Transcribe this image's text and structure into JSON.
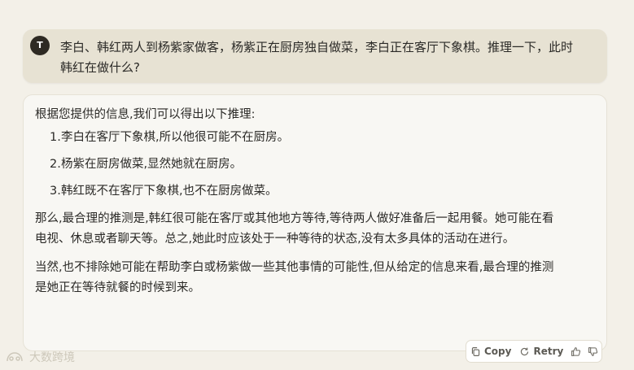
{
  "user": {
    "avatar_initial": "T",
    "message": "李白、韩红两人到杨紫家做客，杨紫正在厨房独自做菜，李白正在客厅下象棋。推理一下，此时韩红在做什么?"
  },
  "assistant": {
    "intro": "根据您提供的信息,我们可以得出以下推理:",
    "list": [
      {
        "num": "1.",
        "text": "李白在客厅下象棋,所以他很可能不在厨房。"
      },
      {
        "num": "2.",
        "text": "杨紫在厨房做菜,显然她就在厨房。"
      },
      {
        "num": "3.",
        "text": "韩红既不在客厅下象棋,也不在厨房做菜。"
      }
    ],
    "para1": "那么,最合理的推测是,韩红很可能在客厅或其他地方等待,等待两人做好准备后一起用餐。她可能在看电视、休息或者聊天等。总之,她此时应该处于一种等待的状态,没有太多具体的活动在进行。",
    "para2": "当然,也不排除她可能在帮助李白或杨紫做一些其他事情的可能性,但从给定的信息来看,最合理的推测是她正在等待就餐的时候到来。"
  },
  "actions": {
    "copy_label": "Copy",
    "retry_label": "Retry"
  },
  "watermark": {
    "text": "大数跨境"
  },
  "colors": {
    "background": "#f3f0e8",
    "user_bubble": "#e7e2d3",
    "assistant_bubble": "#f8f7f3",
    "avatar": "#2e2a23"
  }
}
